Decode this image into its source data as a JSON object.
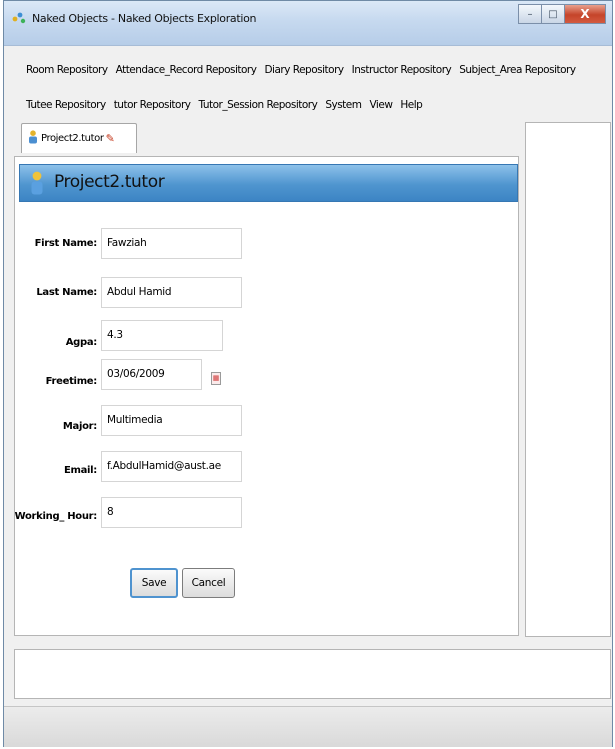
{
  "window": {
    "title": "Naked Objects - Naked Objects Exploration",
    "controls": {
      "minimize": "–",
      "maximize": "□",
      "close": "X"
    }
  },
  "menubar": {
    "row1": [
      "Room Repository",
      "Attendace_Record Repository",
      "Diary Repository",
      "Instructor Repository",
      "Subject_Area Repository"
    ],
    "row2": [
      "Tutee Repository",
      "tutor Repository",
      "Tutor_Session Repository",
      "System",
      "View",
      "Help"
    ]
  },
  "tab": {
    "label": "Project2.tutor"
  },
  "form": {
    "header": "Project2.tutor",
    "fields": [
      {
        "label": "First Name:",
        "value": "Fawziah"
      },
      {
        "label": "Last Name:",
        "value": "Abdul Hamid"
      },
      {
        "label": "Agpa:",
        "value": "4.3"
      },
      {
        "label": "Freetime:",
        "value": "03/06/2009"
      },
      {
        "label": "Major:",
        "value": "Multimedia"
      },
      {
        "label": "Email:",
        "value": "f.AbdulHamid@aust.ae"
      },
      {
        "label": "Working_ Hour:",
        "value": "8"
      }
    ],
    "save_label": "Save",
    "cancel_label": "Cancel"
  },
  "icons": {
    "app": "naked-objects-icon",
    "tutor": "person-icon",
    "edit": "pencil-icon",
    "calendar": "calendar-icon"
  },
  "colors": {
    "header_gradient_top": "#8dc1ea",
    "header_gradient_bottom": "#3c84c4",
    "close_button": "#c5442a",
    "save_border": "#4f93cf"
  }
}
